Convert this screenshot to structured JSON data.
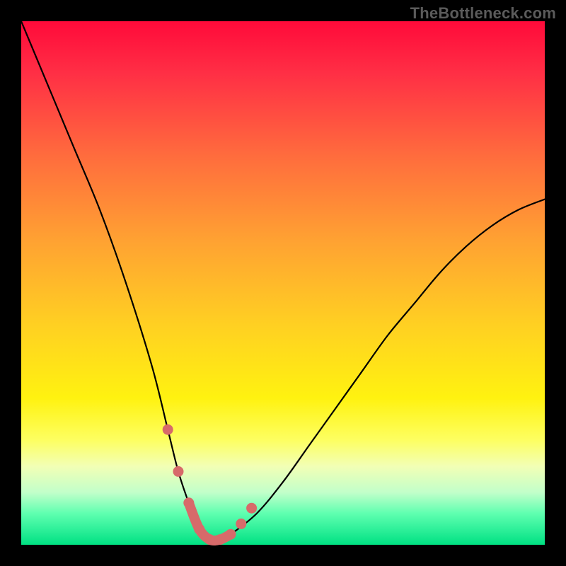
{
  "watermark": "TheBottleneck.com",
  "colors": {
    "frame": "#000000",
    "curve": "#000000",
    "marker": "#d76a6a"
  },
  "chart_data": {
    "type": "line",
    "title": "",
    "xlabel": "",
    "ylabel": "",
    "xlim": [
      0,
      100
    ],
    "ylim": [
      0,
      100
    ],
    "grid": false,
    "legend": false,
    "annotations": [
      "TheBottleneck.com"
    ],
    "series": [
      {
        "name": "bottleneck-curve",
        "x": [
          0,
          5,
          10,
          15,
          20,
          25,
          28,
          30,
          32,
          34,
          36,
          38,
          40,
          45,
          50,
          55,
          60,
          65,
          70,
          75,
          80,
          85,
          90,
          95,
          100
        ],
        "values": [
          100,
          88,
          76,
          64,
          50,
          34,
          22,
          14,
          8,
          3,
          1,
          1,
          2,
          6,
          12,
          19,
          26,
          33,
          40,
          46,
          52,
          57,
          61,
          64,
          66
        ]
      }
    ],
    "markers": {
      "name": "highlighted-points",
      "x": [
        28,
        30,
        32,
        34,
        36,
        38,
        40,
        42,
        44
      ],
      "values": [
        22,
        14,
        8,
        3,
        1,
        1,
        2,
        4,
        7
      ]
    },
    "gradient_stops": [
      {
        "pos": 0.0,
        "color": "#ff0a3a"
      },
      {
        "pos": 0.1,
        "color": "#ff2f45"
      },
      {
        "pos": 0.26,
        "color": "#ff6d3d"
      },
      {
        "pos": 0.42,
        "color": "#ffa232"
      },
      {
        "pos": 0.58,
        "color": "#ffd022"
      },
      {
        "pos": 0.72,
        "color": "#fff210"
      },
      {
        "pos": 0.8,
        "color": "#fdff61"
      },
      {
        "pos": 0.85,
        "color": "#f2ffb5"
      },
      {
        "pos": 0.9,
        "color": "#c2ffca"
      },
      {
        "pos": 0.94,
        "color": "#5fffb0"
      },
      {
        "pos": 1.0,
        "color": "#00e183"
      }
    ]
  }
}
